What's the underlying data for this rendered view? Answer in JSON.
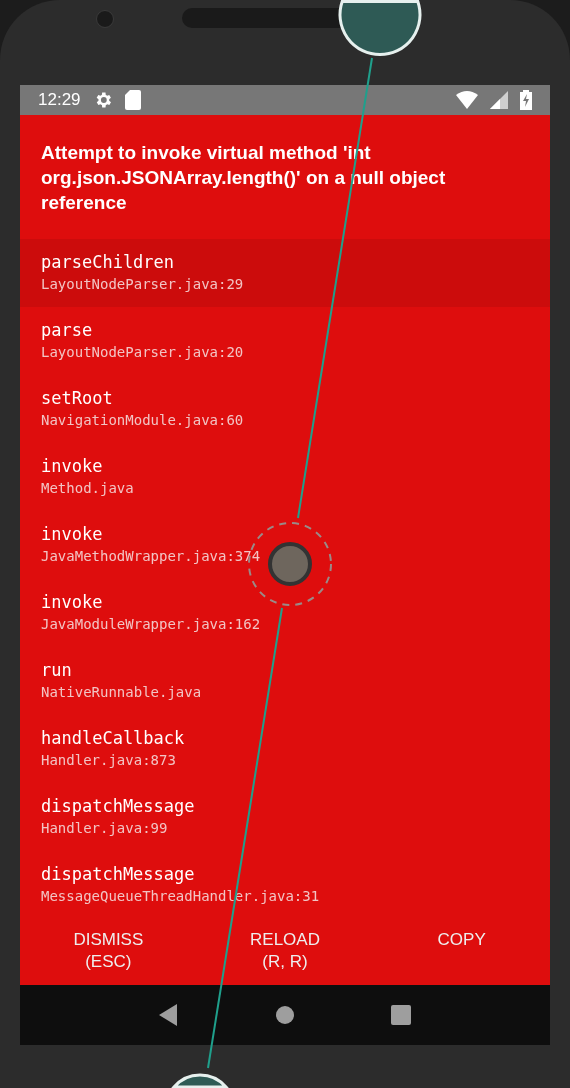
{
  "status_bar": {
    "time": "12:29"
  },
  "error": {
    "message": "Attempt to invoke virtual method 'int org.json.JSONArray.length()' on a null object reference"
  },
  "stack": [
    {
      "method": "parseChildren",
      "file": "LayoutNodeParser.java:29",
      "selected": true
    },
    {
      "method": "parse",
      "file": "LayoutNodeParser.java:20",
      "selected": false
    },
    {
      "method": "setRoot",
      "file": "NavigationModule.java:60",
      "selected": false
    },
    {
      "method": "invoke",
      "file": "Method.java",
      "selected": false
    },
    {
      "method": "invoke",
      "file": "JavaMethodWrapper.java:374",
      "selected": false
    },
    {
      "method": "invoke",
      "file": "JavaModuleWrapper.java:162",
      "selected": false
    },
    {
      "method": "run",
      "file": "NativeRunnable.java",
      "selected": false
    },
    {
      "method": "handleCallback",
      "file": "Handler.java:873",
      "selected": false
    },
    {
      "method": "dispatchMessage",
      "file": "Handler.java:99",
      "selected": false
    },
    {
      "method": "dispatchMessage",
      "file": "MessageQueueThreadHandler.java:31",
      "selected": false
    }
  ],
  "buttons": [
    {
      "label": "DISMISS",
      "shortcut": "(ESC)"
    },
    {
      "label": "RELOAD",
      "shortcut": "(R, R)"
    },
    {
      "label": "COPY"
    }
  ]
}
